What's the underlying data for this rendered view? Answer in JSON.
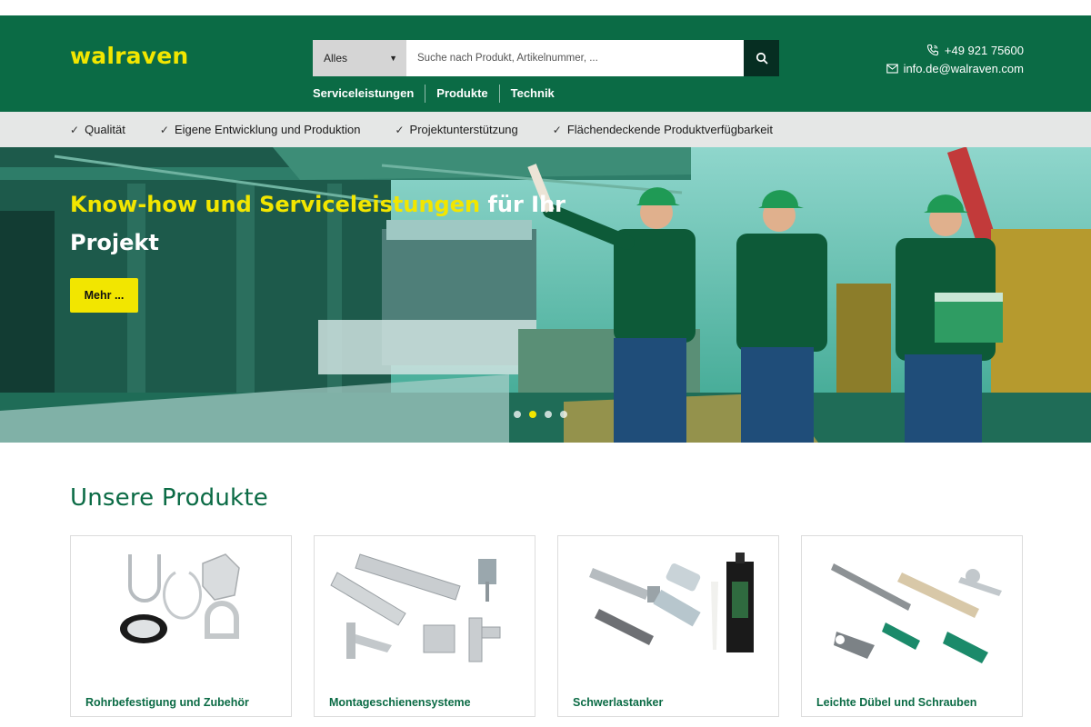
{
  "brand": {
    "logo": "walraven"
  },
  "search": {
    "category": "Alles",
    "placeholder": "Suche nach Produkt, Artikelnummer, ..."
  },
  "nav": {
    "items": [
      "Serviceleistungen",
      "Produkte",
      "Technik"
    ]
  },
  "contact": {
    "phone": "+49 921 75600",
    "email": "info.de@walraven.com"
  },
  "usps": [
    "Qualität",
    "Eigene Entwicklung und Produktion",
    "Projektunterstützung",
    "Flächendeckende Produktverfügbarkeit"
  ],
  "hero": {
    "headline_highlight": "Know-how und Serviceleistungen",
    "headline_rest": " für Ihr Projekt",
    "cta": "Mehr ...",
    "slides": 4,
    "active_slide": 2
  },
  "products": {
    "title": "Unsere Produkte",
    "items": [
      {
        "label": "Rohrbefestigung und Zubehör"
      },
      {
        "label": "Montageschienensysteme"
      },
      {
        "label": "Schwerlastanker"
      },
      {
        "label": "Leichte Dübel und Schrauben"
      }
    ]
  },
  "colors": {
    "brand_green": "#0b6b45",
    "brand_yellow": "#f2e600",
    "search_button": "#062e22"
  }
}
